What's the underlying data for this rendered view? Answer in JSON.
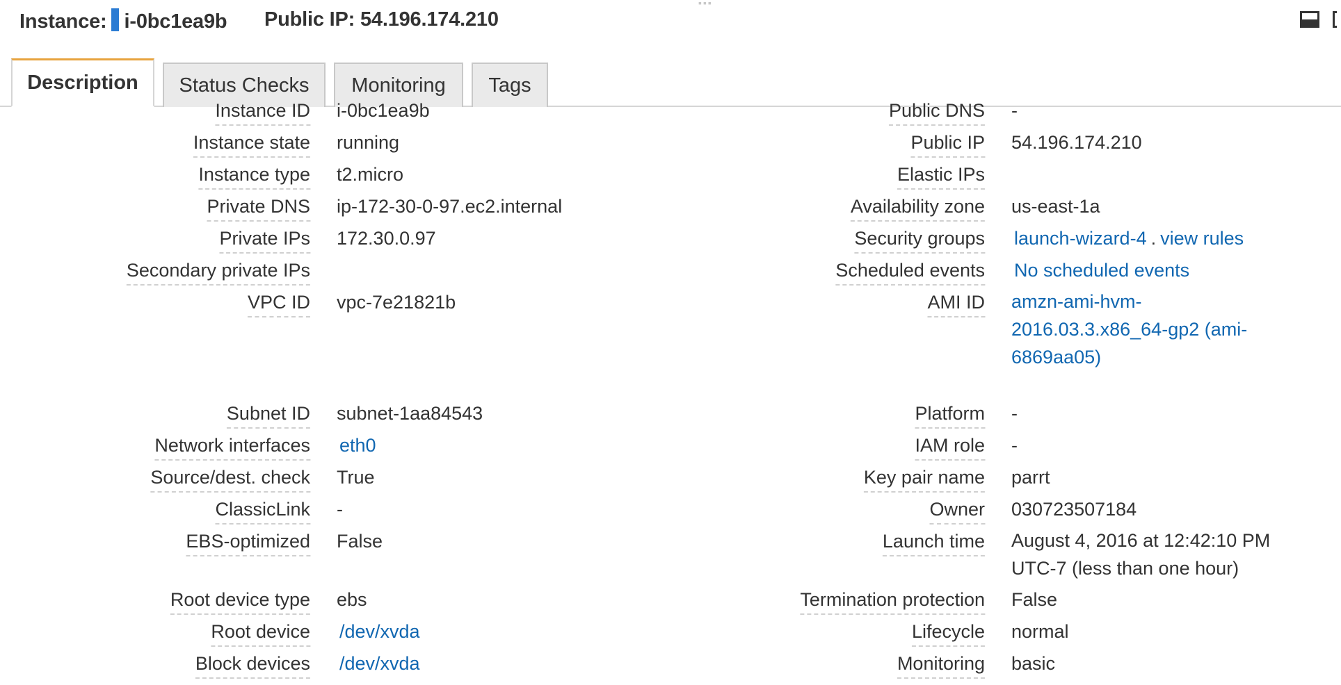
{
  "header": {
    "instance_label": "Instance:",
    "instance_id": "i-0bc1ea9b",
    "public_ip_label": "Public IP: 54.196.174.210"
  },
  "tabs": [
    {
      "label": "Description",
      "active": true
    },
    {
      "label": "Status Checks",
      "active": false
    },
    {
      "label": "Monitoring",
      "active": false
    },
    {
      "label": "Tags",
      "active": false
    }
  ],
  "left": [
    {
      "label": "Instance ID",
      "value": "i-0bc1ea9b"
    },
    {
      "label": "Instance state",
      "value": "running"
    },
    {
      "label": "Instance type",
      "value": "t2.micro"
    },
    {
      "label": "Private DNS",
      "value": "ip-172-30-0-97.ec2.internal"
    },
    {
      "label": "Private IPs",
      "value": "172.30.0.97"
    },
    {
      "label": "Secondary private IPs",
      "value": ""
    },
    {
      "label": "VPC ID",
      "value": "vpc-7e21821b"
    },
    {
      "label": "Subnet ID",
      "value": "subnet-1aa84543"
    },
    {
      "label": "Network interfaces",
      "value": "eth0",
      "link": true
    },
    {
      "label": "Source/dest. check",
      "value": "True"
    },
    {
      "label": "ClassicLink",
      "value": "-"
    },
    {
      "label": "EBS-optimized",
      "value": "False"
    },
    {
      "label": "Root device type",
      "value": "ebs"
    },
    {
      "label": "Root device",
      "value": "/dev/xvda",
      "link": true
    },
    {
      "label": "Block devices",
      "value": "/dev/xvda",
      "link": true
    }
  ],
  "right": [
    {
      "label": "Public DNS",
      "value": "-"
    },
    {
      "label": "Public IP",
      "value": "54.196.174.210"
    },
    {
      "label": "Elastic IPs",
      "value": ""
    },
    {
      "label": "Availability zone",
      "value": "us-east-1a"
    },
    {
      "label": "Security groups",
      "value": "launch-wizard-4",
      "value2": "view rules",
      "separator": ".",
      "link": true
    },
    {
      "label": "Scheduled events",
      "value": "No scheduled events",
      "link": true
    },
    {
      "label": "AMI ID",
      "value": "amzn-ami-hvm-2016.03.3.x86_64-gp2 (ami-6869aa05)",
      "link": true
    },
    {
      "label": "Platform",
      "value": "-"
    },
    {
      "label": "IAM role",
      "value": "-"
    },
    {
      "label": "Key pair name",
      "value": "parrt"
    },
    {
      "label": "Owner",
      "value": "030723507184"
    },
    {
      "label": "Launch time",
      "value": "August 4, 2016 at 12:42:10 PM UTC-7 (less than one hour)"
    },
    {
      "label": "Termination protection",
      "value": "False"
    },
    {
      "label": "Lifecycle",
      "value": "normal"
    },
    {
      "label": "Monitoring",
      "value": "basic"
    }
  ],
  "colors": {
    "link": "#1167b1",
    "active_tab_accent": "#e7a33e",
    "instance_marker": "#2a7bd3"
  }
}
